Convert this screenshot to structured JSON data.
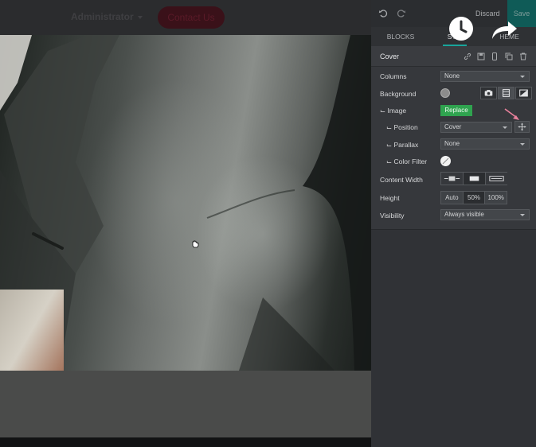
{
  "canvas": {
    "nav": {
      "admin_label": "Administrator",
      "contact_label": "Contact Us"
    }
  },
  "panel": {
    "header": {
      "discard_label": "Discard",
      "save_label": "Save"
    },
    "tabs": [
      {
        "label": "BLOCKS",
        "active": false
      },
      {
        "label": "STYLE",
        "active": true
      },
      {
        "label": "THEME",
        "active": false
      }
    ],
    "tab_visible_text": {
      "style": "STY",
      "theme": "HEME"
    },
    "section": {
      "title": "Cover",
      "tools": [
        "link-icon",
        "save-icon",
        "mobile-icon",
        "copy-icon",
        "trash-icon"
      ]
    },
    "columns": {
      "label": "Columns",
      "value": "None"
    },
    "background": {
      "label": "Background",
      "swatch_color": "#8c8c8c",
      "modes": [
        "camera-icon",
        "video-icon",
        "gradient-icon"
      ],
      "active_mode": "video-icon"
    },
    "image": {
      "label": "⌙ Image",
      "button_label": "Replace"
    },
    "position": {
      "label": "⌙ Position",
      "value": "Cover"
    },
    "parallax": {
      "label": "⌙ Parallax",
      "value": "None"
    },
    "color_filter": {
      "label": "⌙ Color Filter"
    },
    "content_width": {
      "label": "Content Width",
      "options": [
        "narrow-width-icon",
        "normal-width-icon",
        "full-width-icon"
      ],
      "active": "normal-width-icon"
    },
    "height": {
      "label": "Height",
      "options": [
        "Auto",
        "50%",
        "100%"
      ],
      "active": "50%"
    },
    "visibility": {
      "label": "Visibility",
      "value": "Always visible"
    }
  },
  "colors": {
    "accent": "#18a59b",
    "save_bg": "#0f5b57",
    "replace_bg": "#2fa34f",
    "annotation_arrow": "#e8819c"
  }
}
